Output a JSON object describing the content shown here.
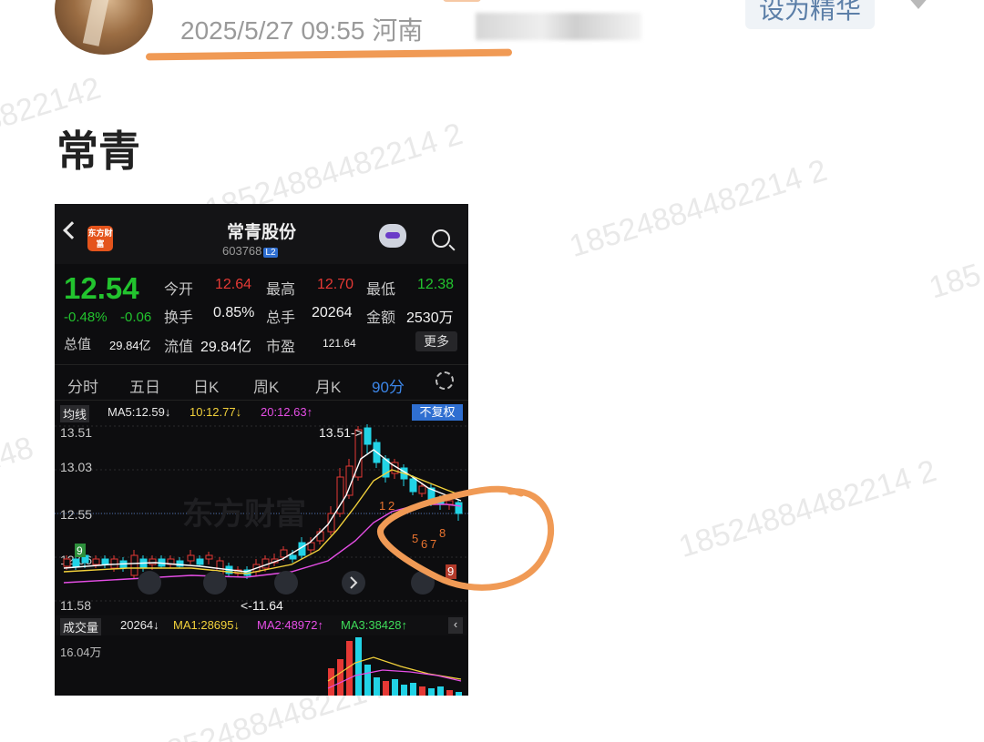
{
  "post": {
    "meta": "2025/5/27 09:55  河南",
    "feature_label": "设为精华",
    "title": "常青"
  },
  "watermark": "18524884482214 2",
  "stock": {
    "name": "常青股份",
    "code": "603768",
    "level_badge": "L2",
    "app_logo": "东方财富",
    "price": "12.54",
    "change_pct": "-0.48%",
    "change": "-0.06",
    "open_label": "今开",
    "open": "12.64",
    "high_label": "最高",
    "high": "12.70",
    "low_label": "最低",
    "low": "12.38",
    "turnover_label": "换手",
    "turnover": "0.85%",
    "vol_label": "总手",
    "vol": "20264",
    "amount_label": "金额",
    "amount": "2530万",
    "mktcap_label": "总值",
    "mktcap": "29.84亿",
    "float_label": "流值",
    "float": "29.84亿",
    "pe_label": "市盈",
    "pe": "121.64",
    "more_label": "更多"
  },
  "tabs": [
    "分时",
    "五日",
    "日K",
    "周K",
    "月K",
    "90分"
  ],
  "active_tab": "90分",
  "ma_line": {
    "selector": "均线",
    "ma5": "MA5:12.59↓",
    "ma10": "10:12.77↓",
    "ma20": "20:12.63↑",
    "adjust": "不复权"
  },
  "price_axis": [
    "13.51",
    "13.03",
    "12.55",
    "12.06",
    "11.58"
  ],
  "annotations": {
    "high": "13.51->",
    "low": "<-11.64"
  },
  "chart_watermark": "东方财富",
  "vol_line": {
    "selector": "成交量",
    "vol": "20264↓",
    "ma1": "MA1:28695↓",
    "ma2": "MA2:48972↑",
    "ma3": "MA3:38428↑",
    "max": "16.04万"
  },
  "td_counts": {
    "left": "9",
    "mid": [
      "1",
      "2"
    ],
    "right": [
      "5",
      "6",
      "7",
      "8",
      "9"
    ]
  },
  "colors": {
    "up": "#e53935",
    "down": "#22d3e6",
    "highlight": "#f09a55",
    "accent": "#2f6fd1"
  }
}
